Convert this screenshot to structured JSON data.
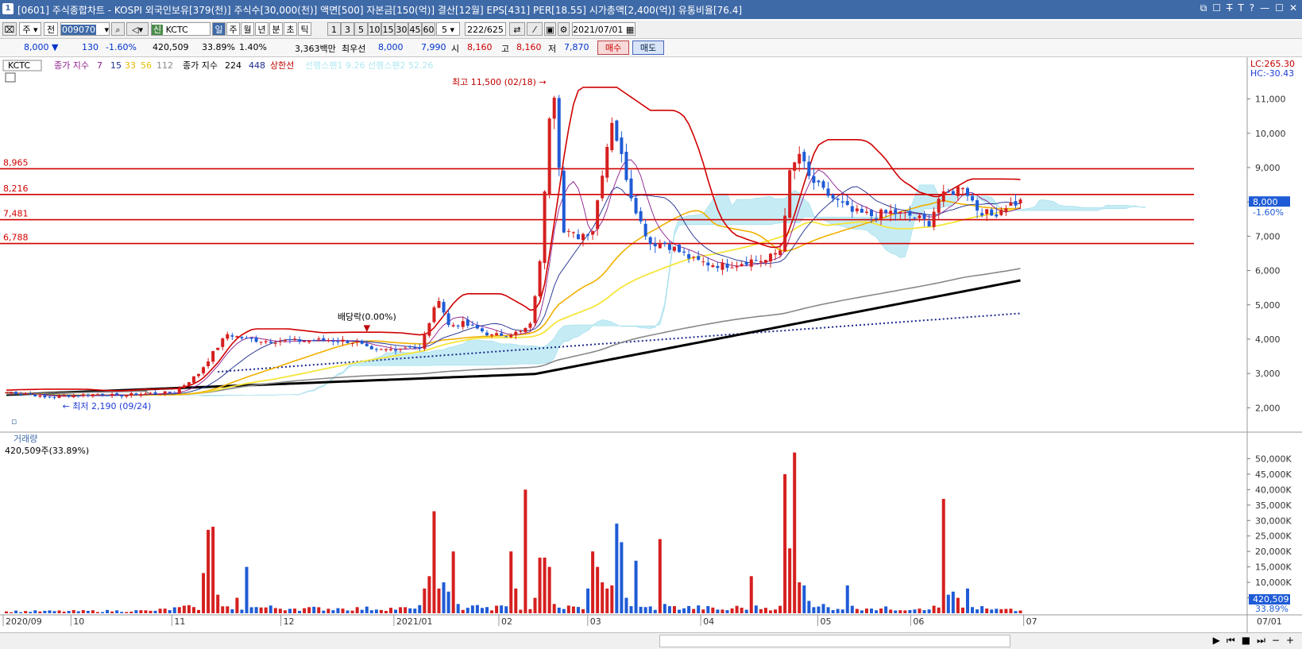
{
  "window": {
    "title": "[0601] 주식종합차트 - KOSPI 외국인보유[379(천)] 주식수[30,000(천)] 액면[500] 자본금[150(억)] 결산[12월] EPS[431] PER[18.55] 시가총액[2,400(억)] 유통비율[76.4]",
    "badge": "1",
    "controls": [
      "⧉",
      "☐",
      "T̶",
      "T",
      "?",
      "—",
      "☐",
      "✕"
    ]
  },
  "toolbar": {
    "mode": "주",
    "period_label": "전",
    "code": "009070",
    "stock_name": "KCTC",
    "stock_tag": "신",
    "period_buttons": [
      "일",
      "주",
      "월",
      "년",
      "분",
      "초",
      "틱"
    ],
    "interval_buttons": [
      "1",
      "3",
      "5",
      "10",
      "15",
      "30",
      "45",
      "60"
    ],
    "interval_value": "5",
    "count": "222",
    "count_total": "/625",
    "date": "2021/07/01"
  },
  "quote": {
    "price": "8,000 ▼",
    "change": "130",
    "change_pct": "-1.60%",
    "volume": "420,509",
    "vol_ratio": "33.89%",
    "turnover": "1.40%",
    "amount": "3,363백만",
    "pref_label": "최우선",
    "ask": "8,000",
    "bid": "7,990",
    "open_label": "시",
    "open": "8,160",
    "high_label": "고",
    "high": "8,160",
    "low_label": "저",
    "low": "7,870",
    "buy_label": "매수",
    "sell_label": "매도"
  },
  "legend": {
    "name": "KCTC",
    "ma_label": "종가 지수",
    "ma_periods": [
      "7",
      "15",
      "33",
      "56",
      "112"
    ],
    "ma_colors": [
      "#8b1a8b",
      "#1a2a8b",
      "#e6b800",
      "#f0d000",
      "#888888"
    ],
    "ma2_label": "종가 지수",
    "ma2_periods": [
      "224",
      "448"
    ],
    "ma2_colors": [
      "#000000",
      "#1a2a8b"
    ],
    "limit_label": "상한선",
    "cloud_label": "선행스팬1 9.26  선행스팬2 52.26"
  },
  "chart_data": [
    {
      "type": "candlestick",
      "title": "KCTC",
      "ylim": [
        1800,
        11800
      ],
      "ticks_y": [
        "11,000",
        "10,000",
        "9,000",
        "8,000",
        "7,000",
        "6,000",
        "5,000",
        "4,000",
        "3,000",
        "2,000"
      ],
      "tick_values_y": [
        11000,
        10000,
        9000,
        8000,
        7000,
        6000,
        5000,
        4000,
        3000,
        2000
      ],
      "horizontal_lines": [
        {
          "label": "8,965",
          "value": 8965,
          "color": "#d00000"
        },
        {
          "label": "8,216",
          "value": 8216,
          "color": "#d00000"
        },
        {
          "label": "7,481",
          "value": 7481,
          "color": "#d00000"
        },
        {
          "label": "6,788",
          "value": 6788,
          "color": "#d00000"
        }
      ],
      "annotations": {
        "high": "최고 11,500 (02/18)",
        "low": "최저 2,190 (09/24)",
        "dividend": "배당락(0.00%)"
      },
      "right_labels": {
        "lc": "LC:265.30",
        "hc": "HC:-30.43",
        "price": "8,000",
        "pct": "-1.60%"
      },
      "anchors_close": [
        [
          0,
          2450
        ],
        [
          5,
          2400
        ],
        [
          8,
          2300
        ],
        [
          12,
          2350
        ],
        [
          16,
          2380
        ],
        [
          20,
          2400
        ],
        [
          23,
          2350
        ],
        [
          27,
          2400
        ],
        [
          30,
          2420
        ],
        [
          35,
          2450
        ],
        [
          40,
          3000
        ],
        [
          43,
          3600
        ],
        [
          46,
          4150
        ],
        [
          50,
          4000
        ],
        [
          54,
          3950
        ],
        [
          58,
          3950
        ],
        [
          62,
          3950
        ],
        [
          66,
          3980
        ],
        [
          70,
          3950
        ],
        [
          73,
          3900
        ],
        [
          76,
          3650
        ],
        [
          80,
          3700
        ],
        [
          84,
          3800
        ],
        [
          86,
          3700
        ],
        [
          88,
          4500
        ],
        [
          90,
          5200
        ],
        [
          92,
          4400
        ],
        [
          95,
          4450
        ],
        [
          98,
          4300
        ],
        [
          101,
          4100
        ],
        [
          104,
          4150
        ],
        [
          107,
          4200
        ],
        [
          109,
          4400
        ],
        [
          111,
          6200
        ],
        [
          113,
          10600
        ],
        [
          114,
          11200
        ],
        [
          116,
          7100
        ],
        [
          119,
          7000
        ],
        [
          122,
          7200
        ],
        [
          124,
          8900
        ],
        [
          126,
          10400
        ],
        [
          128,
          9300
        ],
        [
          130,
          8200
        ],
        [
          132,
          7400
        ],
        [
          134,
          6800
        ],
        [
          137,
          6800
        ],
        [
          140,
          6550
        ],
        [
          143,
          6300
        ],
        [
          146,
          6200
        ],
        [
          149,
          6150
        ],
        [
          152,
          6200
        ],
        [
          155,
          6300
        ],
        [
          158,
          6300
        ],
        [
          161,
          6600
        ],
        [
          163,
          8800
        ],
        [
          165,
          9400
        ],
        [
          167,
          8700
        ],
        [
          170,
          8300
        ],
        [
          173,
          8000
        ],
        [
          176,
          7700
        ],
        [
          180,
          7600
        ],
        [
          184,
          7700
        ],
        [
          188,
          7600
        ],
        [
          192,
          7400
        ],
        [
          194,
          8100
        ],
        [
          197,
          8300
        ],
        [
          199,
          8500
        ],
        [
          202,
          7800
        ],
        [
          205,
          7600
        ],
        [
          208,
          7900
        ],
        [
          211,
          8000
        ]
      ],
      "volume_anchors": [
        [
          0,
          600
        ],
        [
          30,
          800
        ],
        [
          39,
          2000
        ],
        [
          41,
          13000
        ],
        [
          42,
          27000
        ],
        [
          43,
          28000
        ],
        [
          44,
          6000
        ],
        [
          48,
          5000
        ],
        [
          50,
          15000
        ],
        [
          52,
          2000
        ],
        [
          60,
          1500
        ],
        [
          70,
          1500
        ],
        [
          85,
          1500
        ],
        [
          87,
          8000
        ],
        [
          88,
          12000
        ],
        [
          89,
          33000
        ],
        [
          90,
          8000
        ],
        [
          91,
          10000
        ],
        [
          92,
          7000
        ],
        [
          93,
          20000
        ],
        [
          94,
          3000
        ],
        [
          100,
          2000
        ],
        [
          105,
          20000
        ],
        [
          106,
          8000
        ],
        [
          108,
          40000
        ],
        [
          110,
          5000
        ],
        [
          111,
          18000
        ],
        [
          112,
          18000
        ],
        [
          113,
          15000
        ],
        [
          114,
          3000
        ],
        [
          121,
          8000
        ],
        [
          122,
          20000
        ],
        [
          123,
          15000
        ],
        [
          124,
          10000
        ],
        [
          125,
          8000
        ],
        [
          126,
          9000
        ],
        [
          127,
          29000
        ],
        [
          128,
          23000
        ],
        [
          129,
          5000
        ],
        [
          131,
          17000
        ],
        [
          133,
          2000
        ],
        [
          136,
          24000
        ],
        [
          137,
          3000
        ],
        [
          150,
          1000
        ],
        [
          155,
          12000
        ],
        [
          162,
          45000
        ],
        [
          163,
          21000
        ],
        [
          164,
          52000
        ],
        [
          165,
          10000
        ],
        [
          166,
          9000
        ],
        [
          167,
          4000
        ],
        [
          170,
          3000
        ],
        [
          175,
          9000
        ],
        [
          180,
          1500
        ],
        [
          190,
          1500
        ],
        [
          195,
          37000
        ],
        [
          196,
          6000
        ],
        [
          197,
          7000
        ],
        [
          198,
          5000
        ],
        [
          200,
          8000
        ],
        [
          201,
          2000
        ],
        [
          205,
          1200
        ],
        [
          211,
          900
        ]
      ],
      "volume_ticks": [
        "50,000K",
        "45,000K",
        "40,000K",
        "35,000K",
        "30,000K",
        "25,000K",
        "20,000K",
        "15,000K",
        "10,000K",
        "5,000K"
      ],
      "volume_tick_values": [
        50000,
        45000,
        40000,
        35000,
        30000,
        25000,
        20000,
        15000,
        10000,
        5000
      ],
      "volume_max": 55000,
      "volume_title": "거래량",
      "volume_readout": "420,509주(33.89%)",
      "volume_label": "420,509",
      "volume_pct": "33.89%",
      "x_labels": [
        {
          "i": 0,
          "label": "2020/09"
        },
        {
          "i": 16,
          "label": "10"
        },
        {
          "i": 41,
          "label": "11"
        },
        {
          "i": 68,
          "label": "12"
        },
        {
          "i": 96,
          "label": "2021/01"
        },
        {
          "i": 122,
          "label": "02"
        },
        {
          "i": 144,
          "label": "03"
        },
        {
          "i": 172,
          "label": "04"
        },
        {
          "i": 201,
          "label": "05"
        },
        {
          "i": 224,
          "label": "06"
        },
        {
          "i": 252,
          "label": "07"
        }
      ],
      "x_right_label": "07/01"
    }
  ]
}
